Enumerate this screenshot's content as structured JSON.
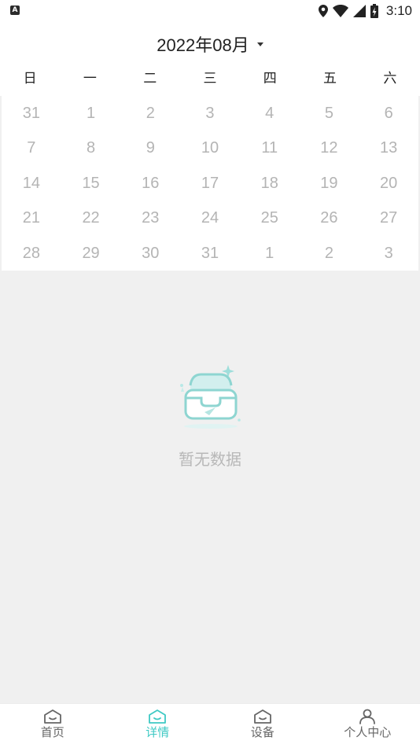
{
  "status_bar": {
    "time": "3:10",
    "app_badge": "A"
  },
  "header": {
    "month_label": "2022年08月"
  },
  "calendar": {
    "weekdays": [
      "日",
      "一",
      "二",
      "三",
      "四",
      "五",
      "六"
    ],
    "days": [
      "31",
      "1",
      "2",
      "3",
      "4",
      "5",
      "6",
      "7",
      "8",
      "9",
      "10",
      "11",
      "12",
      "13",
      "14",
      "15",
      "16",
      "17",
      "18",
      "19",
      "20",
      "21",
      "22",
      "23",
      "24",
      "25",
      "26",
      "27",
      "28",
      "29",
      "30",
      "31",
      "1",
      "2",
      "3"
    ]
  },
  "empty_state": {
    "text": "暂无数据",
    "icon": "empty-box-icon"
  },
  "tabbar": {
    "items": [
      {
        "label": "首页",
        "icon": "home-icon",
        "active": false
      },
      {
        "label": "详情",
        "icon": "detail-icon",
        "active": true
      },
      {
        "label": "设备",
        "icon": "device-icon",
        "active": false
      },
      {
        "label": "个人中心",
        "icon": "person-icon",
        "active": false
      }
    ]
  },
  "colors": {
    "accent": "#3ec9c4",
    "day_text": "#b4b4b4",
    "background": "#f0f0f0"
  }
}
